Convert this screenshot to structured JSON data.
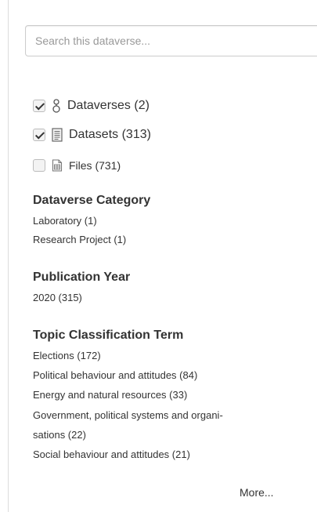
{
  "search": {
    "placeholder": "Search this dataverse..."
  },
  "type_filters": [
    {
      "label": "Dataverses (2)",
      "checked": true,
      "icon": "dataverse-icon"
    },
    {
      "label": "Datasets (313)",
      "checked": true,
      "icon": "dataset-icon"
    },
    {
      "label": "Files (731)",
      "checked": false,
      "icon": "file-icon"
    }
  ],
  "facets": {
    "dataverse_category": {
      "title": "Dataverse Category",
      "items": [
        "Laboratory (1)",
        "Research Project (1)"
      ]
    },
    "publication_year": {
      "title": "Publication Year",
      "items": [
        "2020 (315)"
      ]
    },
    "topic_classification": {
      "title": "Topic Classification Term",
      "items": [
        "Elections (172)",
        "Political behaviour and attitudes (84)",
        "Energy and natural resources (33)",
        "Government, political systems and organi-",
        "sations (22)",
        "Social behaviour and attitudes (21)"
      ],
      "more_label": "More..."
    }
  }
}
